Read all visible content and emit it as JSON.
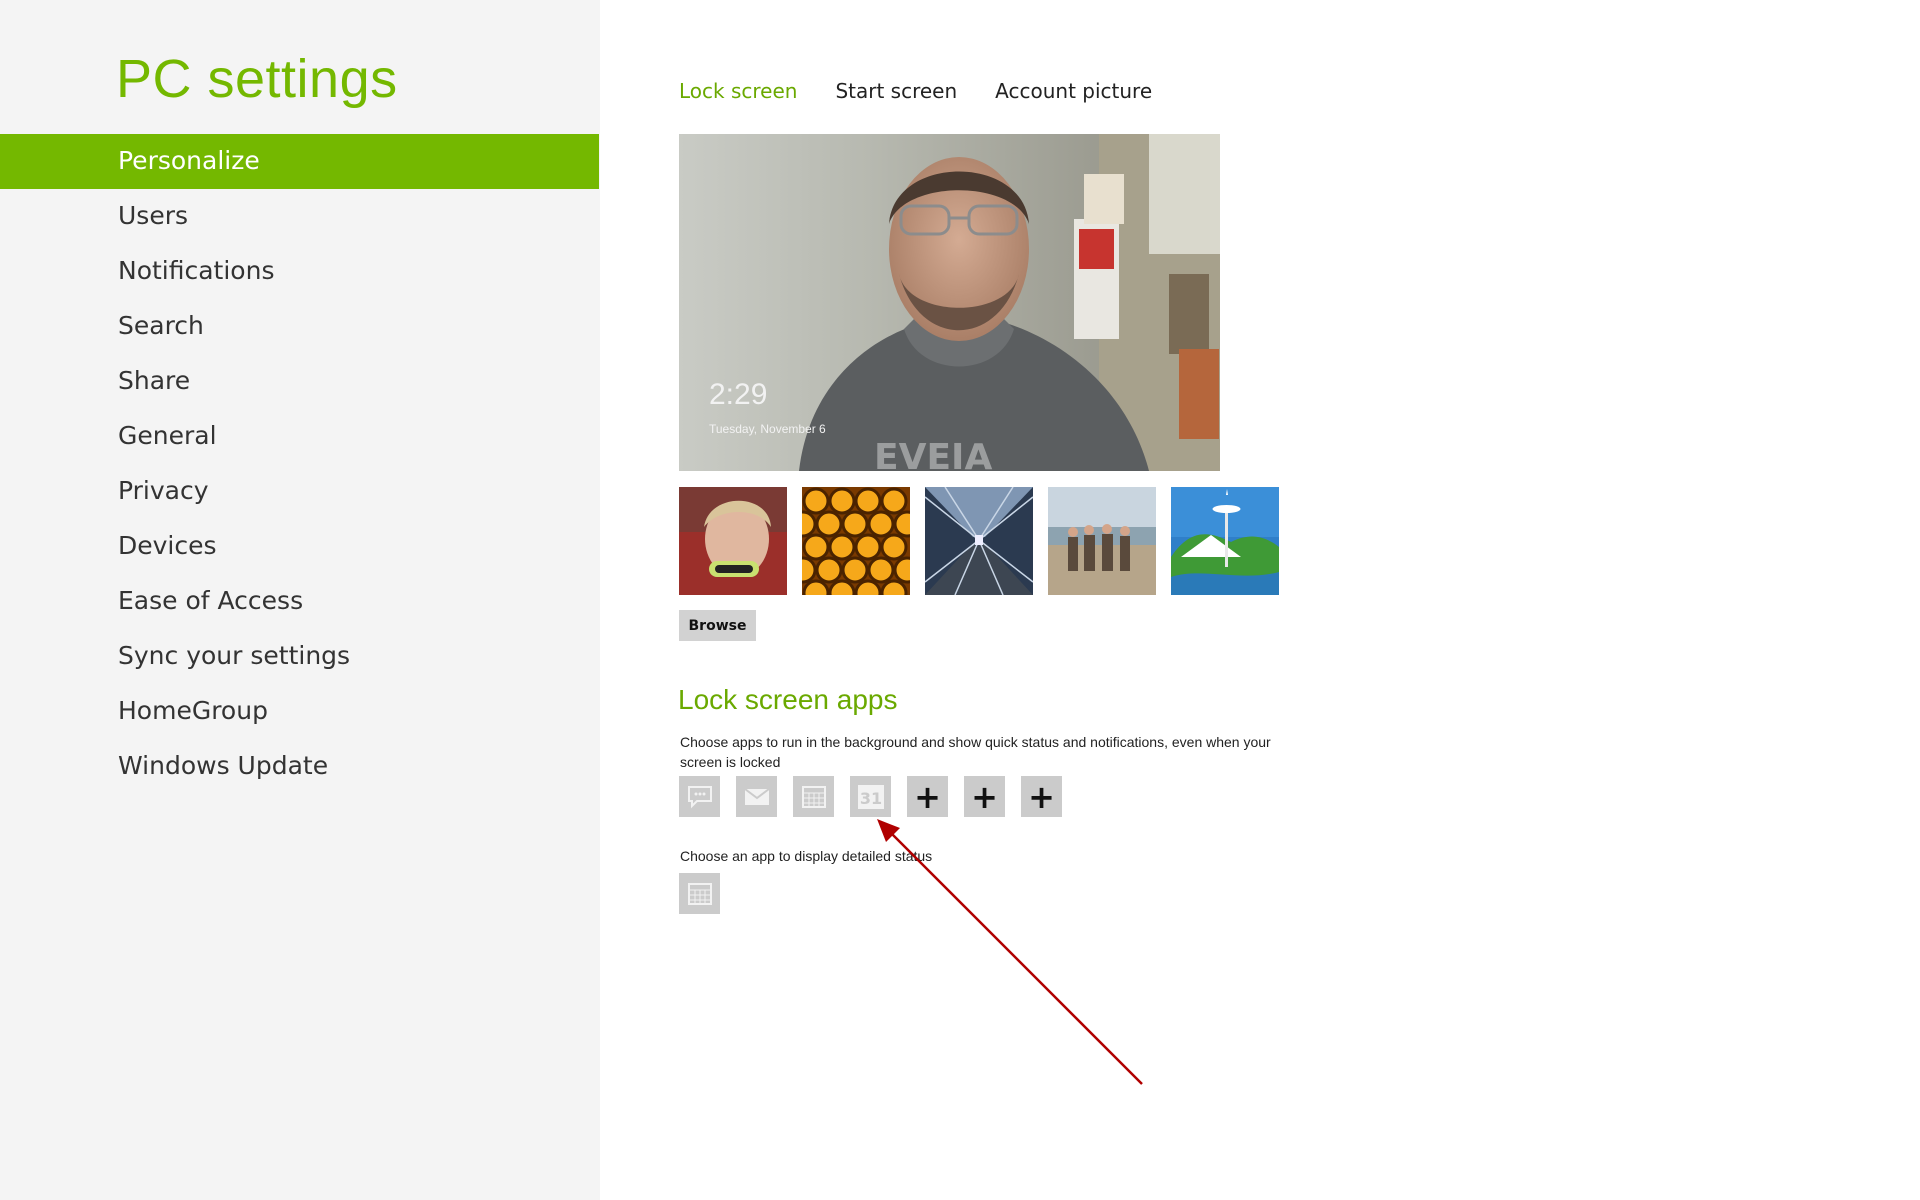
{
  "sidebar": {
    "title": "PC settings",
    "items": [
      {
        "label": "Personalize",
        "active": true
      },
      {
        "label": "Users"
      },
      {
        "label": "Notifications"
      },
      {
        "label": "Search"
      },
      {
        "label": "Share"
      },
      {
        "label": "General"
      },
      {
        "label": "Privacy"
      },
      {
        "label": "Devices"
      },
      {
        "label": "Ease of Access"
      },
      {
        "label": "Sync your settings"
      },
      {
        "label": "HomeGroup"
      },
      {
        "label": "Windows Update"
      }
    ]
  },
  "tabs": [
    {
      "label": "Lock screen",
      "active": true
    },
    {
      "label": "Start screen"
    },
    {
      "label": "Account picture"
    }
  ],
  "lock_screen": {
    "time": "2:29",
    "date": "Tuesday, November 6"
  },
  "browse_label": "Browse",
  "lock_apps": {
    "title": "Lock screen apps",
    "description": "Choose apps to run in the background and show quick status and notifications, even when your screen is locked",
    "slots": [
      "messaging-icon",
      "mail-icon",
      "calendar-icon",
      "calendar-31-icon",
      "add-icon",
      "add-icon",
      "add-icon"
    ],
    "calendar_day": "31",
    "plus_glyph": "+",
    "detail_label": "Choose an app to display detailed status",
    "detail_slot": "calendar-icon"
  },
  "colors": {
    "accent": "#74b800",
    "sidebar_bg": "#f4f4f4",
    "slot_bg": "#cbcbcb",
    "annotation_arrow": "#b00000"
  }
}
